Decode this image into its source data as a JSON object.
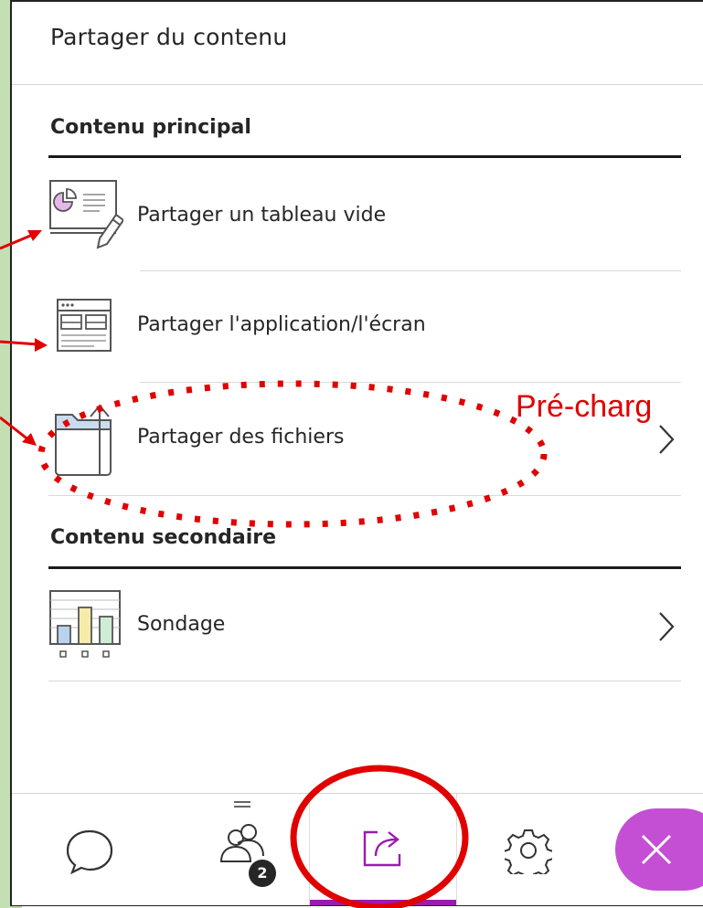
{
  "panel": {
    "title": "Partager du contenu"
  },
  "primary": {
    "heading": "Contenu principal",
    "items": [
      {
        "label": "Partager un tableau vide",
        "icon": "whiteboard-icon"
      },
      {
        "label": "Partager l'application/l'écran",
        "icon": "application-screen-icon"
      },
      {
        "label": "Partager des fichiers",
        "icon": "folder-upload-icon",
        "has_chevron": true
      }
    ]
  },
  "secondary": {
    "heading": "Contenu secondaire",
    "items": [
      {
        "label": "Sondage",
        "icon": "poll-chart-icon",
        "has_chevron": true
      }
    ]
  },
  "bottom_bar": {
    "items": [
      {
        "name": "chat",
        "icon": "chat-bubble-icon"
      },
      {
        "name": "attendees",
        "icon": "attendees-icon",
        "badge": "2"
      },
      {
        "name": "share-content",
        "icon": "share-content-icon",
        "active": true
      },
      {
        "name": "settings",
        "icon": "gear-icon"
      },
      {
        "name": "close",
        "icon": "close-icon"
      }
    ]
  },
  "annotation": {
    "text": "Pré-charg"
  },
  "colors": {
    "accent_purple": "#9b1bb0",
    "close_button": "#c44fd4",
    "annotation_red": "#e00000",
    "left_background": "#c5dfb4"
  }
}
